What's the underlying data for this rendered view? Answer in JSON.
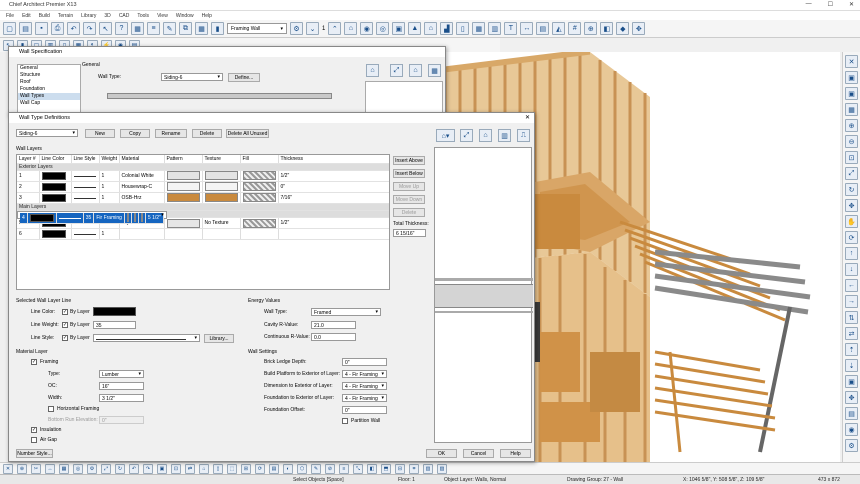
{
  "app": {
    "title": "Chief Architect Premier X13",
    "win_min": "—",
    "win_max": "☐",
    "win_close": "✕"
  },
  "menu": [
    "File",
    "Edit",
    "Build",
    "Terrain",
    "Library",
    "3D",
    "CAD",
    "Tools",
    "View",
    "Window",
    "Help"
  ],
  "toolbar": {
    "wall_type": "Framing Wall",
    "number": "1"
  },
  "wall_spec": {
    "title": "Wall Specification",
    "tree": [
      "General",
      "Structure",
      "Roof",
      "Foundation",
      "Wall Types",
      "Wall Cap"
    ],
    "section": "General",
    "wall_type_label": "Wall Type:",
    "wall_type_value": "Siding-6",
    "define_label": "Define..."
  },
  "wtd": {
    "title": "Wall Type Definitions",
    "close": "✕",
    "wall_type": "Siding-6",
    "buttons": {
      "new": "New",
      "copy": "Copy",
      "rename": "Rename",
      "delete": "Delete",
      "delete_unused": "Delete All Unused"
    },
    "wall_layers_label": "Wall Layers",
    "headers": [
      "Layer #",
      "Line Color",
      "Line Style",
      "Weight",
      "Material",
      "Pattern",
      "Texture",
      "Fill",
      "Thickness"
    ],
    "groups": {
      "exterior": "Exterior Layers",
      "main": "Main Layers",
      "interior": "Interior Layers"
    },
    "rows_exterior": [
      {
        "n": "1",
        "weight": "1",
        "material": "Colonial White",
        "texture": "",
        "thickness": "1/2\""
      },
      {
        "n": "2",
        "weight": "1",
        "material": "Housewrap-C",
        "texture": "",
        "thickness": "0\""
      },
      {
        "n": "3",
        "weight": "1",
        "material": "OSB-Hrz",
        "texture": "",
        "thickness": "7/16\""
      }
    ],
    "rows_main": [
      {
        "n": "4",
        "weight": "35",
        "material": "Fir Framing",
        "texture": "",
        "thickness": "5 1/2\""
      }
    ],
    "rows_interior": [
      {
        "n": "5",
        "weight": "1",
        "material": "Drywall",
        "texture": "No Texture",
        "thickness": "1/2\""
      },
      {
        "n": "6",
        "weight": "1",
        "material": "",
        "texture": "",
        "thickness": ""
      }
    ],
    "side": {
      "insert_above": "Insert Above",
      "insert_below": "Insert Below",
      "move_up": "Move Up",
      "move_down": "Move Down",
      "delete": "Delete",
      "total_label": "Total Thickness:",
      "total": "6 15/16\""
    },
    "selected_line": {
      "label": "Selected Wall Layer Line",
      "color_label": "Line Color:",
      "weight_label": "Line Weight:",
      "style_label": "Line Style:",
      "by_layer": "By Layer",
      "weight_value": "35",
      "library": "Library..."
    },
    "energy": {
      "label": "Energy Values",
      "type_label": "Wall Type:",
      "type": "Framed",
      "cavity_label": "Cavity R-Value:",
      "cavity": "21.0",
      "cont_label": "Continuous R-Value:",
      "cont": "0.0"
    },
    "material_layer": {
      "label": "Material Layer",
      "framing": "Framing",
      "type_label": "Type:",
      "type": "Lumber",
      "oc_label": "OC:",
      "oc": "16\"",
      "width_label": "Width:",
      "width": "3 1/2\"",
      "horizontal": "Horizontal Framing",
      "bottom_label": "Bottom Run Elevation:",
      "bottom": "0\"",
      "insulation": "Insulation",
      "air_gap": "Air Gap"
    },
    "wall_settings": {
      "label": "Wall Settings",
      "brick_label": "Brick Ledge Depth:",
      "brick": "0\"",
      "build_label": "Build Platform to Exterior of Layer:",
      "build": "4 - Fir Framing",
      "dim_label": "Dimension to Exterior of Layer:",
      "dim": "4 - Fir Framing",
      "found_label": "Foundation to Exterior of Layer:",
      "found": "4 - Fir Framing",
      "offset_label": "Foundation Offset:",
      "offset": "0\"",
      "partition": "Partition Wall"
    },
    "footer": {
      "number_style": "Number Style...",
      "ok": "OK",
      "cancel": "Cancel",
      "help": "Help"
    }
  },
  "status": {
    "select": "Select Objects [Space]",
    "floor": "Floor: 1",
    "layer": "Object Layer: Walls, Normal",
    "drawing": "Drawing Group: 27 - Wall",
    "coords": "X: 1046 5/8\", Y: 508 5/8\", Z: 109 5/8\"",
    "size": "473 x 872"
  },
  "colors": {
    "selected_row": "#1565c0",
    "lumber": "#d9a667",
    "osb": "#c98a3e",
    "sky": "#ffffff"
  }
}
